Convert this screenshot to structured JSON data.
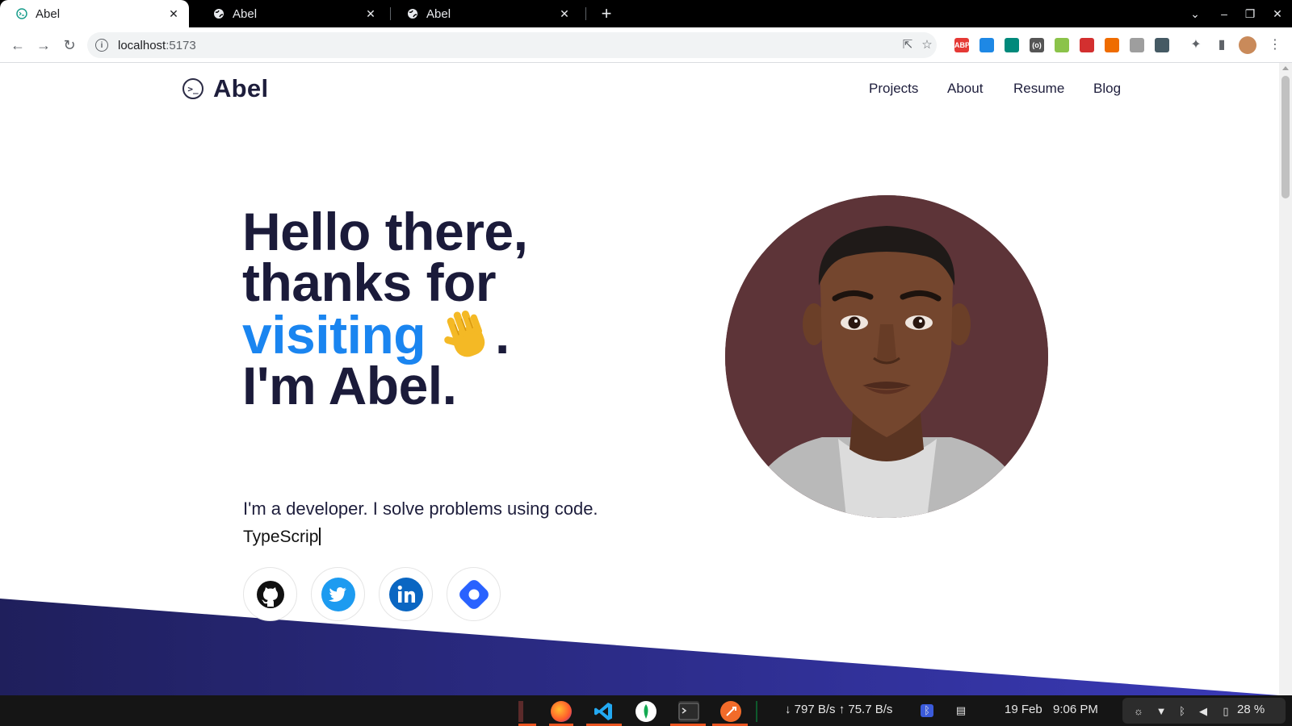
{
  "browser": {
    "tabs": [
      {
        "title": "Abel",
        "active": true
      },
      {
        "title": "Abel",
        "active": false
      },
      {
        "title": "Abel",
        "active": false
      }
    ],
    "url_host": "localhost",
    "url_port": ":5173",
    "extensions": [
      {
        "icon": "adblock-plus-icon",
        "label": "ABP",
        "color": "#e53935"
      },
      {
        "icon": "docs-extension-icon",
        "label": "",
        "color": "#1e88e5"
      },
      {
        "icon": "sheets-extension-icon",
        "label": "",
        "color": "#00897b"
      },
      {
        "icon": "code-extension-icon",
        "label": "(o)",
        "color": "#555555"
      },
      {
        "icon": "color-extension-icon",
        "label": "",
        "color": "#8bc34a"
      },
      {
        "icon": "red-extension-icon",
        "label": "",
        "color": "#d32f2f"
      },
      {
        "icon": "orange-extension-icon",
        "label": "",
        "color": "#ef6c00"
      },
      {
        "icon": "shield-extension-icon",
        "label": "",
        "color": "#9e9e9e"
      },
      {
        "icon": "glasses-extension-icon",
        "label": "",
        "color": "#455a64"
      }
    ]
  },
  "site": {
    "brand": "Abel",
    "nav": [
      "Projects",
      "About",
      "Resume",
      "Blog"
    ],
    "hero": {
      "line1": "Hello there,",
      "line2": "thanks for",
      "line3_accent": "visiting",
      "line3_end": ".",
      "line4": "I'm Abel."
    },
    "subtitle": "I'm a developer. I solve problems using code.",
    "typed_text": "TypeScrip",
    "socials": [
      {
        "name": "github",
        "icon": "github-icon"
      },
      {
        "name": "twitter",
        "icon": "twitter-icon"
      },
      {
        "name": "linkedin",
        "icon": "linkedin-icon"
      },
      {
        "name": "hashnode",
        "icon": "hashnode-icon"
      }
    ],
    "colors": {
      "text": "#1b1b3a",
      "accent": "#1a85f0",
      "band_start": "#1f1f5c",
      "band_end": "#3a3ab8"
    }
  },
  "taskbar": {
    "network": "↓ 797 B/s ↑ 75.7 B/s",
    "date": "19 Feb",
    "time": "9:06 PM",
    "battery": "28 %"
  }
}
